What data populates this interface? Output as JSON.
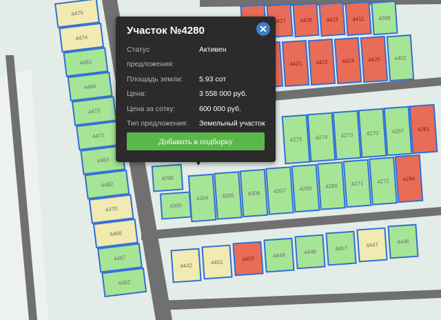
{
  "popup": {
    "title": "Участок №4280",
    "close_glyph": "✕",
    "rows": [
      {
        "label": "Статус",
        "value": "Активен"
      },
      {
        "label": "предложения:",
        "value": ""
      },
      {
        "label": "Площадь земли:",
        "value": "5.93 сот"
      },
      {
        "label": "Цена:",
        "value": "3 558 000 руб."
      },
      {
        "label": "Цена за сотку:",
        "value": "600 000 руб."
      },
      {
        "label": "Тип предложения:",
        "value": "Земельный участок"
      }
    ],
    "button_label": "Добавить в подборку"
  },
  "map": {
    "colors": {
      "available": "#a6e596",
      "sold": "#e96c57",
      "reserved": "#f1eab1",
      "border": "#2f6fd6",
      "road": "#6f6f6f"
    },
    "left_column": [
      {
        "n": "4475",
        "s": "reserved"
      },
      {
        "n": "4474",
        "s": "reserved"
      },
      {
        "n": "4481",
        "s": "available"
      },
      {
        "n": "4484",
        "s": "available"
      },
      {
        "n": "4472",
        "s": "available"
      },
      {
        "n": "4471",
        "s": "available"
      },
      {
        "n": "4483",
        "s": "available"
      },
      {
        "n": "4482",
        "s": "available"
      },
      {
        "n": "4470",
        "s": "reserved"
      },
      {
        "n": "4466",
        "s": "reserved"
      },
      {
        "n": "4467",
        "s": "available"
      },
      {
        "n": "4462",
        "s": "available"
      }
    ],
    "top_rows": [
      {
        "n": "4428",
        "s": "sold"
      },
      {
        "n": "4427",
        "s": "sold"
      },
      {
        "n": "4426",
        "s": "sold"
      },
      {
        "n": "4423",
        "s": "sold"
      },
      {
        "n": "4411",
        "s": "sold"
      },
      {
        "n": "4398",
        "s": "available"
      },
      {
        "n": "4419",
        "s": "sold"
      },
      {
        "n": "4421",
        "s": "sold"
      },
      {
        "n": "4422",
        "s": "sold"
      },
      {
        "n": "4424",
        "s": "sold"
      },
      {
        "n": "4425",
        "s": "sold"
      },
      {
        "n": "4402",
        "s": "available"
      }
    ],
    "middle_row": [
      {
        "n": "4275",
        "s": "available"
      },
      {
        "n": "4274",
        "s": "available"
      },
      {
        "n": "4273",
        "s": "available"
      },
      {
        "n": "4270",
        "s": "available"
      },
      {
        "n": "4267",
        "s": "available"
      },
      {
        "n": "4261",
        "s": "sold"
      }
    ],
    "lower_row": [
      {
        "n": "4299",
        "s": "available"
      },
      {
        "n": "4300",
        "s": "available"
      },
      {
        "n": "4304",
        "s": "available"
      },
      {
        "n": "4305",
        "s": "available"
      },
      {
        "n": "4306",
        "s": "available"
      },
      {
        "n": "4307",
        "s": "available"
      },
      {
        "n": "4268",
        "s": "available"
      },
      {
        "n": "4269",
        "s": "available"
      },
      {
        "n": "4271",
        "s": "available"
      },
      {
        "n": "4272",
        "s": "available"
      },
      {
        "n": "4294",
        "s": "sold"
      }
    ],
    "bottom_row": [
      {
        "n": "4442",
        "s": "reserved"
      },
      {
        "n": "4451",
        "s": "reserved"
      },
      {
        "n": "4450",
        "s": "sold"
      },
      {
        "n": "4449",
        "s": "available"
      },
      {
        "n": "4448",
        "s": "available"
      },
      {
        "n": "4457",
        "s": "available"
      },
      {
        "n": "4447",
        "s": "reserved"
      },
      {
        "n": "4446",
        "s": "available"
      }
    ]
  }
}
